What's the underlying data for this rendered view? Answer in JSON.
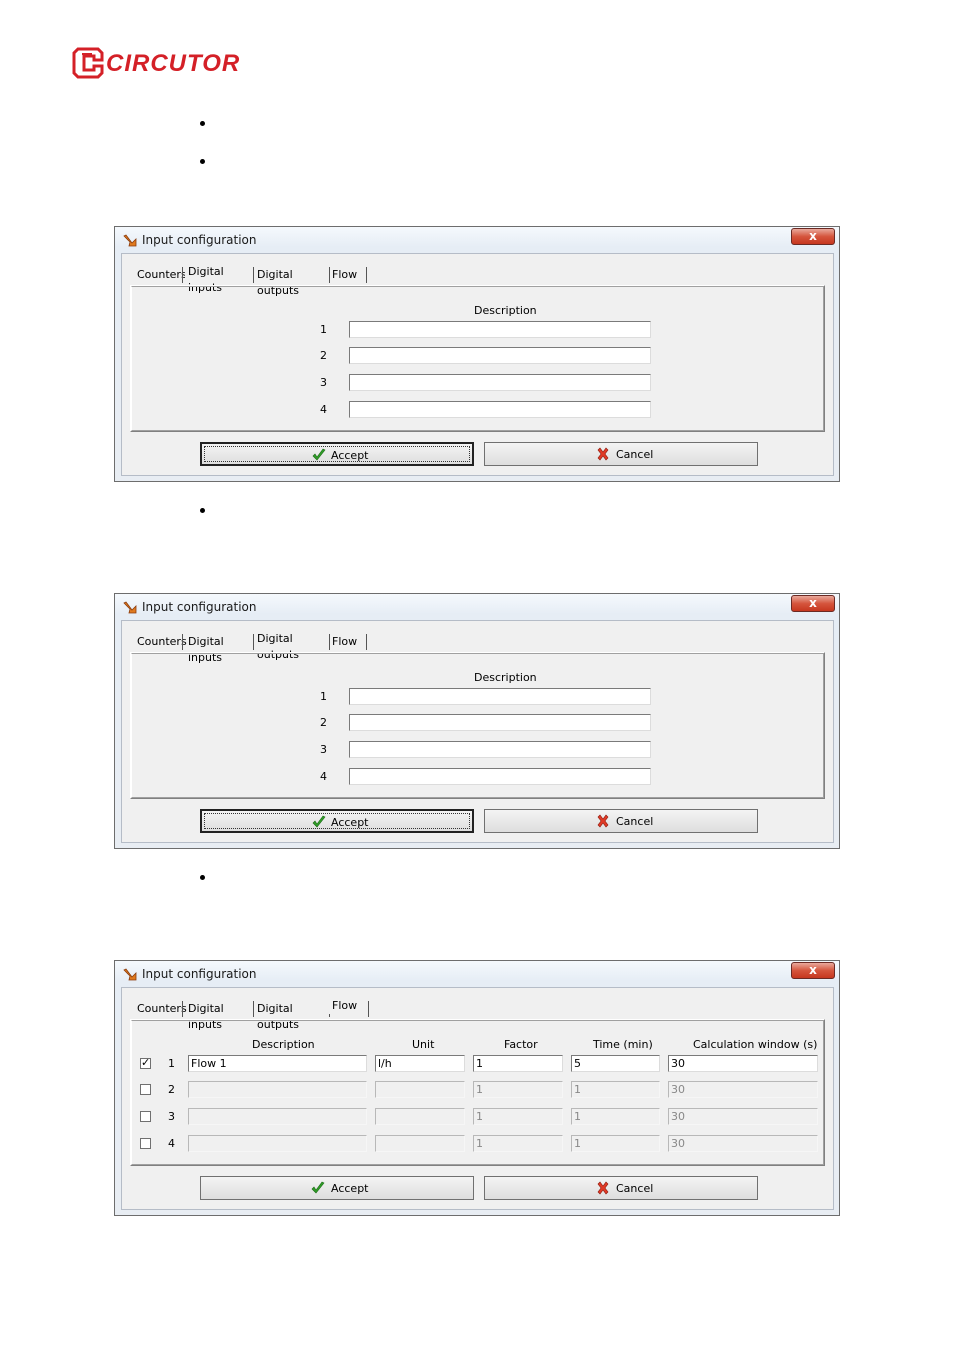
{
  "logo": {
    "text": "CIRCUTOR",
    "color": "#d42027"
  },
  "dialogs": [
    {
      "title": "Input configuration",
      "close_label": "x",
      "tabs": [
        "Counters",
        "Digital inputs",
        "Digital outputs",
        "Flow"
      ],
      "active_tab": "Digital inputs",
      "description_header": "Description",
      "rows": [
        {
          "num": "1",
          "value": ""
        },
        {
          "num": "2",
          "value": ""
        },
        {
          "num": "3",
          "value": ""
        },
        {
          "num": "4",
          "value": ""
        }
      ],
      "accept_label": "Accept",
      "cancel_label": "Cancel"
    },
    {
      "title": "Input configuration",
      "close_label": "x",
      "tabs": [
        "Counters",
        "Digital inputs",
        "Digital outputs",
        "Flow"
      ],
      "active_tab": "Digital outputs",
      "description_header": "Description",
      "rows": [
        {
          "num": "1",
          "value": ""
        },
        {
          "num": "2",
          "value": ""
        },
        {
          "num": "3",
          "value": ""
        },
        {
          "num": "4",
          "value": ""
        }
      ],
      "accept_label": "Accept",
      "cancel_label": "Cancel"
    },
    {
      "title": "Input configuration",
      "close_label": "x",
      "tabs": [
        "Counters",
        "Digital inputs",
        "Digital outputs",
        "Flow"
      ],
      "active_tab": "Flow",
      "columns": [
        "Description",
        "Unit",
        "Factor",
        "Time (min)",
        "Calculation window (s)"
      ],
      "flow_rows": [
        {
          "checked": true,
          "num": "1",
          "description": "Flow 1",
          "unit": "l/h",
          "factor": "1",
          "time": "5",
          "window": "30"
        },
        {
          "checked": false,
          "num": "2",
          "description": "",
          "unit": "",
          "factor": "1",
          "time": "1",
          "window": "30"
        },
        {
          "checked": false,
          "num": "3",
          "description": "",
          "unit": "",
          "factor": "1",
          "time": "1",
          "window": "30"
        },
        {
          "checked": false,
          "num": "4",
          "description": "",
          "unit": "",
          "factor": "1",
          "time": "1",
          "window": "30"
        }
      ],
      "accept_label": "Accept",
      "cancel_label": "Cancel"
    }
  ]
}
